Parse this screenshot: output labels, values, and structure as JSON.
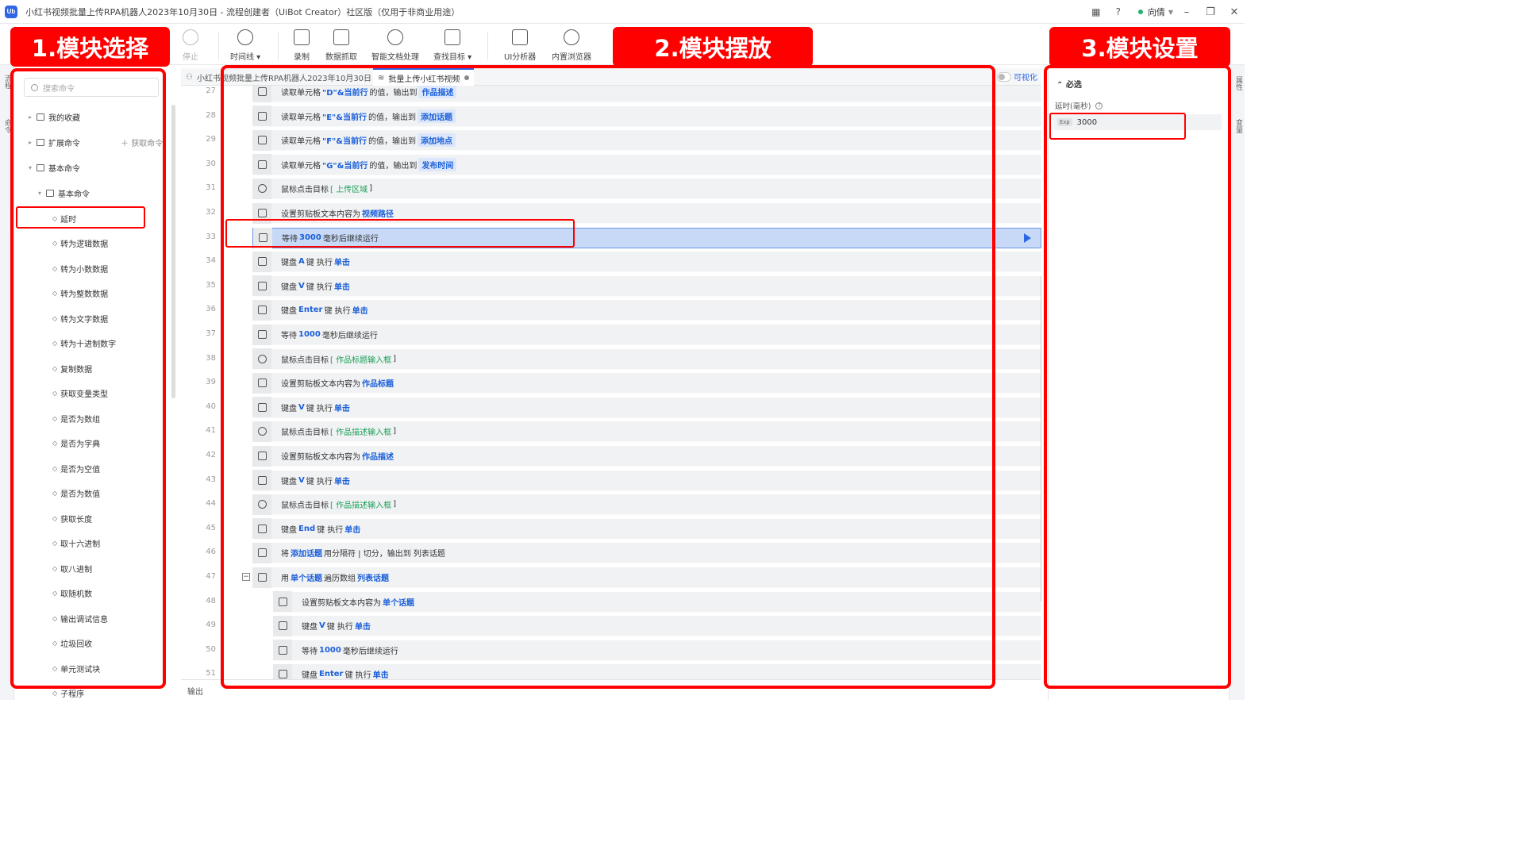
{
  "title_bar": {
    "title": "小红书视频批量上传RPA机器人2023年10月30日 - 流程创建者（UiBot Creator）社区版（仅用于非商业用途）",
    "logo_text": "Ub",
    "user_name": "向倩"
  },
  "toolbar": {
    "stop": "停止",
    "timeline": "时间线",
    "record": "录制",
    "data_scrape": "数据抓取",
    "smart_doc": "智能文档处理",
    "find_target": "查找目标",
    "ui_analyzer": "UI分析器",
    "browser": "内置浏览器"
  },
  "left_panel": {
    "search_placeholder": "搜索命令",
    "strip_label_top": "流程",
    "strip_label_mid": "命令",
    "favorites": "我的收藏",
    "extensions": "扩展命令",
    "get_command": "获取命令",
    "basic": "基本命令",
    "basic_sub": "基本命令",
    "items": [
      "延时",
      "转为逻辑数据",
      "转为小数数据",
      "转为整数数据",
      "转为文字数据",
      "转为十进制数字",
      "复制数据",
      "获取变量类型",
      "是否为数组",
      "是否为字典",
      "是否为空值",
      "是否为数值",
      "获取长度",
      "取十六进制",
      "取八进制",
      "取随机数",
      "输出调试信息",
      "垃圾回收",
      "单元测试块",
      "子程序"
    ]
  },
  "tabs": {
    "tab1": "小红书视频批量上传RPA机器人2023年10月30日",
    "tab2": "批量上传小红书视频",
    "visual": "可视化"
  },
  "code_rows": [
    {
      "ln": "27",
      "icon": "excel-read",
      "parts": [
        [
          "t",
          "读取单元格 "
        ],
        [
          "v",
          "\"D\"&当前行"
        ],
        [
          "t",
          " 的值，输出到 "
        ],
        [
          "p",
          "作品描述"
        ]
      ]
    },
    {
      "ln": "28",
      "icon": "excel-read",
      "parts": [
        [
          "t",
          "读取单元格 "
        ],
        [
          "v",
          "\"E\"&当前行"
        ],
        [
          "t",
          " 的值，输出到 "
        ],
        [
          "p",
          "添加话题"
        ]
      ]
    },
    {
      "ln": "29",
      "icon": "excel-read",
      "parts": [
        [
          "t",
          "读取单元格 "
        ],
        [
          "v",
          "\"F\"&当前行"
        ],
        [
          "t",
          " 的值，输出到 "
        ],
        [
          "p",
          "添加地点"
        ]
      ]
    },
    {
      "ln": "30",
      "icon": "excel-read",
      "parts": [
        [
          "t",
          "读取单元格 "
        ],
        [
          "v",
          "\"G\"&当前行"
        ],
        [
          "t",
          " 的值，输出到 "
        ],
        [
          "p",
          "发布时间"
        ]
      ]
    },
    {
      "ln": "31",
      "icon": "mouse",
      "parts": [
        [
          "t",
          "鼠标点击目标 "
        ],
        [
          "g",
          "[ 上传区域"
        ],
        [
          "t",
          "       ]"
        ]
      ]
    },
    {
      "ln": "32",
      "icon": "clipboard",
      "parts": [
        [
          "t",
          "设置剪贴板文本内容为 "
        ],
        [
          "v",
          "视频路径"
        ]
      ]
    },
    {
      "ln": "33",
      "icon": "delay",
      "active": true,
      "parts": [
        [
          "t",
          "等待 "
        ],
        [
          "v",
          "3000"
        ],
        [
          "t",
          " 毫秒后继续运行"
        ]
      ]
    },
    {
      "ln": "34",
      "icon": "keyboard",
      "parts": [
        [
          "t",
          "键盘 "
        ],
        [
          "v",
          "A"
        ],
        [
          "t",
          " 键 执行 "
        ],
        [
          "v",
          "单击"
        ]
      ]
    },
    {
      "ln": "35",
      "icon": "keyboard",
      "parts": [
        [
          "t",
          "键盘 "
        ],
        [
          "v",
          "V"
        ],
        [
          "t",
          " 键 执行 "
        ],
        [
          "v",
          "单击"
        ]
      ]
    },
    {
      "ln": "36",
      "icon": "keyboard",
      "parts": [
        [
          "t",
          "键盘 "
        ],
        [
          "v",
          "Enter"
        ],
        [
          "t",
          " 键 执行 "
        ],
        [
          "v",
          "单击"
        ]
      ]
    },
    {
      "ln": "37",
      "icon": "delay",
      "parts": [
        [
          "t",
          "等待 "
        ],
        [
          "v",
          "1000"
        ],
        [
          "t",
          " 毫秒后继续运行"
        ]
      ]
    },
    {
      "ln": "38",
      "icon": "mouse",
      "parts": [
        [
          "t",
          "鼠标点击目标 "
        ],
        [
          "g",
          "[ 作品标题输入框"
        ],
        [
          "t",
          "         ]"
        ]
      ]
    },
    {
      "ln": "39",
      "icon": "clipboard",
      "parts": [
        [
          "t",
          "设置剪贴板文本内容为 "
        ],
        [
          "v",
          "作品标题"
        ]
      ]
    },
    {
      "ln": "40",
      "icon": "keyboard",
      "parts": [
        [
          "t",
          "键盘 "
        ],
        [
          "v",
          "V"
        ],
        [
          "t",
          " 键 执行 "
        ],
        [
          "v",
          "单击"
        ]
      ]
    },
    {
      "ln": "41",
      "icon": "mouse",
      "parts": [
        [
          "t",
          "鼠标点击目标 "
        ],
        [
          "g",
          "[ 作品描述输入框"
        ],
        [
          "t",
          "         ]"
        ]
      ]
    },
    {
      "ln": "42",
      "icon": "clipboard",
      "parts": [
        [
          "t",
          "设置剪贴板文本内容为 "
        ],
        [
          "v",
          "作品描述"
        ]
      ]
    },
    {
      "ln": "43",
      "icon": "keyboard",
      "parts": [
        [
          "t",
          "键盘 "
        ],
        [
          "v",
          "V"
        ],
        [
          "t",
          " 键 执行 "
        ],
        [
          "v",
          "单击"
        ]
      ]
    },
    {
      "ln": "44",
      "icon": "mouse",
      "parts": [
        [
          "t",
          "鼠标点击目标 "
        ],
        [
          "g",
          "[ 作品描述输入框"
        ],
        [
          "t",
          "         ]"
        ]
      ]
    },
    {
      "ln": "45",
      "icon": "keyboard",
      "parts": [
        [
          "t",
          "键盘 "
        ],
        [
          "v",
          "End"
        ],
        [
          "t",
          " 键 执行 "
        ],
        [
          "v",
          "单击"
        ]
      ]
    },
    {
      "ln": "46",
      "icon": "split",
      "parts": [
        [
          "t",
          "将 "
        ],
        [
          "v",
          "添加话题"
        ],
        [
          "t",
          " 用分隔符 | 切分，输出到 列表话题"
        ]
      ]
    },
    {
      "ln": "47",
      "icon": "loop",
      "fold": "⊟",
      "parts": [
        [
          "t",
          "用 "
        ],
        [
          "v",
          "单个话题"
        ],
        [
          "t",
          " 遍历数组 "
        ],
        [
          "v",
          "列表话题"
        ]
      ]
    },
    {
      "ln": "48",
      "icon": "clipboard",
      "nested": true,
      "parts": [
        [
          "t",
          "设置剪贴板文本内容为 "
        ],
        [
          "v",
          "单个话题"
        ]
      ]
    },
    {
      "ln": "49",
      "icon": "keyboard",
      "nested": true,
      "parts": [
        [
          "t",
          "键盘 "
        ],
        [
          "v",
          "V"
        ],
        [
          "t",
          " 键 执行 "
        ],
        [
          "v",
          "单击"
        ]
      ]
    },
    {
      "ln": "50",
      "icon": "delay",
      "nested": true,
      "parts": [
        [
          "t",
          "等待 "
        ],
        [
          "v",
          "1000"
        ],
        [
          "t",
          " 毫秒后继续运行"
        ]
      ]
    },
    {
      "ln": "51",
      "icon": "keyboard",
      "nested": true,
      "parts": [
        [
          "t",
          "键盘 "
        ],
        [
          "v",
          "Enter"
        ],
        [
          "t",
          " 键 执行 "
        ],
        [
          "v",
          "单击"
        ]
      ]
    }
  ],
  "output_label": "输出",
  "right_panel": {
    "section": "必选",
    "field_label": "延时(毫秒)",
    "expr_tag": "Exp",
    "field_value": "3000",
    "strip_label_top": "属性",
    "strip_label_mid": "变量"
  },
  "annotations": {
    "label1": "1.模块选择",
    "label2": "2.模块摆放",
    "label3": "3.模块设置",
    "color": "#ff0000"
  },
  "colors": {
    "accent": "#2e66e6",
    "value_blue": "#1a5fd8",
    "target_green": "#18a058",
    "active_row": "#c7d9f7"
  }
}
